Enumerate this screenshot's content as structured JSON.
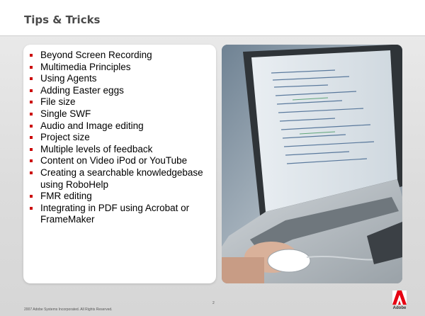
{
  "slide": {
    "title": "Tips & Tricks",
    "bullets": [
      "Beyond Screen Recording",
      "Multimedia Principles",
      "Using Agents",
      "Adding Easter eggs",
      "File size",
      "Single SWF",
      "Audio and Image editing",
      "Project size",
      "Multiple levels of feedback",
      "Content on Video iPod or YouTube",
      "Creating a searchable knowledgebase using RoboHelp",
      "FMR editing",
      "Integrating in PDF using Acrobat or FrameMaker"
    ]
  },
  "footer": {
    "copyright": "2007 Adobe Systems Incorporated.  All Rights Reserved.",
    "page_number": "2",
    "logo_text": "Adobe"
  },
  "colors": {
    "bullet": "#cc0000",
    "logo": "#e60012",
    "title": "#4a4a4a"
  },
  "icons": {
    "logo": "adobe-logo-icon"
  }
}
